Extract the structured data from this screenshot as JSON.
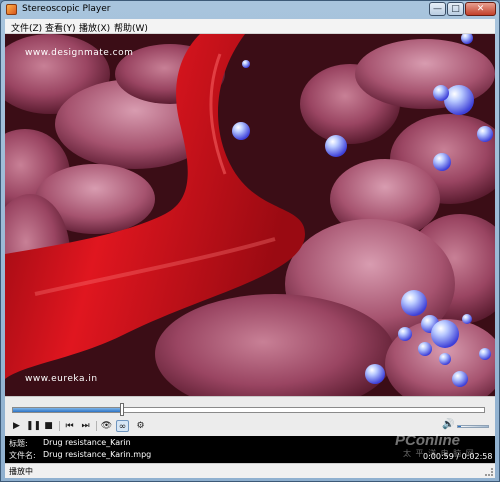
{
  "window": {
    "title": "Stereoscopic Player",
    "controls": {
      "minimize": "—",
      "maximize": "□",
      "close": "✕"
    }
  },
  "menu": {
    "items": [
      {
        "label": "文件(Z)"
      },
      {
        "label": "查看(Y)"
      },
      {
        "label": "播放(X)"
      },
      {
        "label": "帮助(W)"
      }
    ]
  },
  "video": {
    "watermark_top": "www.designmate.com",
    "watermark_bottom": "www.eureka.in"
  },
  "playback": {
    "progress_fraction": 0.229
  },
  "controls": {
    "icons": [
      {
        "name": "play-icon",
        "glyph": "▶"
      },
      {
        "name": "pause-icon",
        "glyph": "❚❚"
      },
      {
        "name": "stop-icon",
        "glyph": "■"
      },
      {
        "name": "previous-icon",
        "glyph": "⏮"
      },
      {
        "name": "next-icon",
        "glyph": "⏭"
      },
      {
        "name": "eye-view-icon",
        "glyph": "👁"
      },
      {
        "name": "stereo-glasses-icon",
        "glyph": "∞"
      },
      {
        "name": "options-icon",
        "glyph": "⚙"
      }
    ],
    "volume_icon": "🔊",
    "volume_level": 0.1
  },
  "info": {
    "title_label": "标题:",
    "title_value": "Drug resistance_Karin",
    "file_label": "文件名:",
    "file_value": "Drug resistance_Karin.mpg",
    "time_display": "0:00:59 / 0:02:58",
    "brand": "PConline",
    "brand_sub": "太 平 洋 电 脑 网"
  },
  "status": {
    "text": "播放中"
  },
  "colors": {
    "accent": "#2d74c6",
    "vessel": "#c8101c",
    "tissue": "#8a3a55"
  }
}
